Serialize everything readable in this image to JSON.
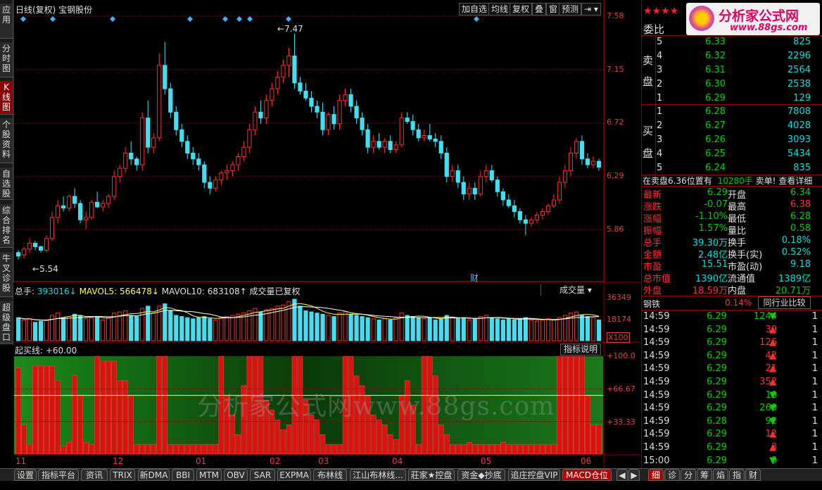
{
  "left_nav": [
    "应用",
    "分时图",
    "K线图",
    "个股资料",
    "自选股",
    "综合排名",
    "牛叉诊股",
    "超级盘口"
  ],
  "header": {
    "title": "日线(复权)  宝钢股份"
  },
  "toolbar": [
    "加自选",
    "均线",
    "复权",
    "叠",
    "窗",
    "预测"
  ],
  "price_axis": [
    "7.58",
    "7.15",
    "6.72",
    "6.29",
    "5.86"
  ],
  "annotations": {
    "high": "7.47",
    "low": "5.54",
    "cai_marker": "财"
  },
  "volume": {
    "header_prefix": "总手:",
    "total": "393016↓",
    "mavol5_label": "MAVOL5:",
    "mavol5": "566478↓",
    "mavol10_label": "MAVOL10:",
    "mavol10": "683108↑",
    "note": "成交量已复权",
    "selector": "成交量",
    "axis": [
      "36349",
      "18174",
      "X100"
    ]
  },
  "indicator": {
    "header": "起买线: +60.00",
    "button": "指标说明",
    "axis": [
      "+100.0",
      "+66.67",
      "+33.33"
    ]
  },
  "watermark": "分析家公式网www.88gs.com",
  "x_axis": [
    "11",
    "12",
    "01",
    "02",
    "03",
    "04",
    "05",
    "06"
  ],
  "tabs": [
    "设置",
    "指标平台",
    "资讯",
    "TRIX",
    "新DMA",
    "BBI",
    "MTM",
    "OBV",
    "SAR",
    "EXPMA",
    "布林线",
    "江山布林线...",
    "莊家★控盘",
    "资金◆抄底",
    "追庄控盘VIP",
    "MACD仓位"
  ],
  "right_panel": {
    "stars": "★★★★",
    "logo_text": "分析家公式网",
    "logo_url": "www.88gs.com",
    "weibi_label": "委比",
    "sell_label": [
      "卖",
      "盘"
    ],
    "buy_label": [
      "买",
      "盘"
    ],
    "sell": [
      {
        "n": "5",
        "price": "6.33",
        "vol": "825"
      },
      {
        "n": "4",
        "price": "6.32",
        "vol": "2296"
      },
      {
        "n": "3",
        "price": "6.31",
        "vol": "2564"
      },
      {
        "n": "2",
        "price": "6.30",
        "vol": "2538"
      },
      {
        "n": "1",
        "price": "6.29",
        "vol": "129"
      }
    ],
    "buy": [
      {
        "n": "1",
        "price": "6.28",
        "vol": "7808"
      },
      {
        "n": "2",
        "price": "6.27",
        "vol": "4028"
      },
      {
        "n": "3",
        "price": "6.26",
        "vol": "3093"
      },
      {
        "n": "4",
        "price": "6.25",
        "vol": "5434"
      },
      {
        "n": "5",
        "price": "6.24",
        "vol": "835"
      }
    ],
    "notice_left": "在卖盘6.36位置有",
    "notice_mid": "10280手",
    "notice_right": "卖单! 查看详细",
    "stats": [
      {
        "l1": "最新",
        "v1": "6.29",
        "l2": "开盘",
        "v2": "6.34"
      },
      {
        "l1": "涨跌",
        "v1": "-0.07",
        "l2": "最高",
        "v2": "6.38"
      },
      {
        "l1": "涨幅",
        "v1": "-1.10%",
        "l2": "最低",
        "v2": "6.28"
      },
      {
        "l1": "振幅",
        "v1": "1.57%",
        "l2": "量比",
        "v2": "0.58"
      },
      {
        "l1": "总手",
        "v1": "39.30万",
        "l2": "换手",
        "v2": "0.18%"
      },
      {
        "l1": "金额",
        "v1": "2.48亿",
        "l2": "换手(实)",
        "v2": "0.52%"
      },
      {
        "l1": "市盈",
        "v1": "15.51",
        "l2": "市盈(动)",
        "v2": "9.18"
      },
      {
        "l1": "总市值",
        "v1": "1390亿",
        "l2": "流通值",
        "v2": "1389亿"
      },
      {
        "l1": "外盘",
        "v1": "18.59万",
        "l2": "内盘",
        "v2": "20.71万"
      }
    ],
    "sector": "钢铁",
    "sector_pct": "0.14%",
    "sector_btn": "同行业比较",
    "trades": [
      {
        "t": "14:59",
        "p": "6.29",
        "v": "1244",
        "d": "down",
        "c": "1"
      },
      {
        "t": "14:59",
        "p": "6.29",
        "v": "39",
        "d": "up",
        "c": "1"
      },
      {
        "t": "14:59",
        "p": "6.29",
        "v": "126",
        "d": "up",
        "c": "1"
      },
      {
        "t": "14:59",
        "p": "6.29",
        "v": "42",
        "d": "up",
        "c": "1"
      },
      {
        "t": "14:59",
        "p": "6.29",
        "v": "21",
        "d": "up",
        "c": "1"
      },
      {
        "t": "14:59",
        "p": "6.29",
        "v": "352",
        "d": "up",
        "c": "1"
      },
      {
        "t": "14:59",
        "p": "6.29",
        "v": "10",
        "d": "down",
        "c": "1"
      },
      {
        "t": "14:59",
        "p": "6.29",
        "v": "260",
        "d": "down",
        "c": "1"
      },
      {
        "t": "14:59",
        "p": "6.28",
        "v": "92",
        "d": "down",
        "c": "1"
      },
      {
        "t": "14:59",
        "p": "6.29",
        "v": "12",
        "d": "up",
        "c": "1"
      },
      {
        "t": "14:59",
        "p": "6.29",
        "v": "3",
        "d": "up",
        "c": "1"
      },
      {
        "t": "15:00",
        "p": "6.29",
        "v": "0",
        "d": "down",
        "c": "1"
      }
    ],
    "bottom_tabs": [
      "细",
      "诊",
      "分",
      "筹",
      "焰",
      "指",
      "财"
    ]
  },
  "colors": {
    "up": "#ff3030",
    "down": "#40e0f0",
    "grid": "#8b0000",
    "ma": "#ffffff",
    "bg": "#000000"
  },
  "chart_data": {
    "type": "candlestick",
    "y_range": [
      5.4,
      7.65
    ],
    "candles": [
      [
        5.6,
        5.62,
        5.54,
        5.57
      ],
      [
        5.58,
        5.65,
        5.55,
        5.63
      ],
      [
        5.63,
        5.72,
        5.6,
        5.68
      ],
      [
        5.68,
        5.7,
        5.62,
        5.65
      ],
      [
        5.65,
        5.66,
        5.6,
        5.62
      ],
      [
        5.62,
        5.75,
        5.6,
        5.72
      ],
      [
        5.72,
        5.95,
        5.7,
        5.9
      ],
      [
        5.9,
        6.05,
        5.85,
        6.0
      ],
      [
        6.0,
        6.08,
        5.95,
        5.98
      ],
      [
        5.98,
        6.1,
        5.95,
        6.08
      ],
      [
        6.08,
        6.15,
        5.98,
        6.02
      ],
      [
        6.02,
        6.05,
        5.85,
        5.88
      ],
      [
        5.88,
        5.95,
        5.8,
        5.9
      ],
      [
        5.9,
        6.05,
        5.88,
        6.03
      ],
      [
        6.03,
        6.12,
        5.98,
        5.99
      ],
      [
        5.99,
        6.05,
        5.95,
        6.02
      ],
      [
        6.02,
        6.1,
        5.98,
        6.08
      ],
      [
        6.08,
        6.3,
        6.05,
        6.25
      ],
      [
        6.25,
        6.35,
        6.2,
        6.32
      ],
      [
        6.32,
        6.5,
        6.28,
        6.45
      ],
      [
        6.45,
        6.55,
        6.35,
        6.4
      ],
      [
        6.4,
        6.42,
        6.3,
        6.35
      ],
      [
        6.35,
        6.8,
        6.3,
        6.75
      ],
      [
        6.75,
        6.9,
        6.45,
        6.5
      ],
      [
        6.5,
        6.62,
        6.45,
        6.58
      ],
      [
        6.58,
        7.3,
        6.55,
        7.2
      ],
      [
        7.2,
        7.4,
        6.95,
        7.0
      ],
      [
        7.0,
        7.05,
        6.75,
        6.8
      ],
      [
        6.8,
        6.85,
        6.6,
        6.65
      ],
      [
        6.65,
        6.7,
        6.5,
        6.55
      ],
      [
        6.55,
        6.6,
        6.4,
        6.45
      ],
      [
        6.45,
        6.5,
        6.35,
        6.4
      ],
      [
        6.4,
        6.45,
        6.3,
        6.35
      ],
      [
        6.35,
        6.38,
        6.15,
        6.2
      ],
      [
        6.2,
        6.25,
        6.1,
        6.15
      ],
      [
        6.15,
        6.25,
        6.12,
        6.22
      ],
      [
        6.22,
        6.3,
        6.18,
        6.28
      ],
      [
        6.28,
        6.35,
        6.22,
        6.3
      ],
      [
        6.3,
        6.38,
        6.25,
        6.35
      ],
      [
        6.35,
        6.45,
        6.3,
        6.42
      ],
      [
        6.42,
        6.55,
        6.38,
        6.5
      ],
      [
        6.5,
        6.7,
        6.45,
        6.65
      ],
      [
        6.65,
        6.85,
        6.6,
        6.8
      ],
      [
        6.8,
        6.9,
        6.7,
        6.75
      ],
      [
        6.75,
        6.95,
        6.7,
        6.9
      ],
      [
        6.9,
        7.05,
        6.85,
        7.0
      ],
      [
        7.0,
        7.15,
        6.95,
        7.1
      ],
      [
        7.1,
        7.25,
        7.05,
        7.2
      ],
      [
        7.2,
        7.35,
        7.1,
        7.28
      ],
      [
        7.28,
        7.47,
        7.0,
        7.05
      ],
      [
        7.05,
        7.1,
        6.95,
        6.98
      ],
      [
        6.98,
        7.05,
        6.9,
        6.92
      ],
      [
        6.92,
        6.98,
        6.8,
        6.85
      ],
      [
        6.85,
        6.9,
        6.75,
        6.8
      ],
      [
        6.8,
        6.88,
        6.6,
        6.65
      ],
      [
        6.65,
        6.8,
        6.6,
        6.78
      ],
      [
        6.78,
        6.85,
        6.65,
        6.7
      ],
      [
        6.7,
        6.95,
        6.65,
        6.9
      ],
      [
        6.9,
        7.0,
        6.85,
        6.95
      ],
      [
        6.95,
        7.0,
        6.8,
        6.85
      ],
      [
        6.85,
        6.9,
        6.7,
        6.75
      ],
      [
        6.75,
        6.8,
        6.6,
        6.65
      ],
      [
        6.65,
        6.7,
        6.45,
        6.5
      ],
      [
        6.5,
        6.6,
        6.45,
        6.55
      ],
      [
        6.55,
        6.62,
        6.48,
        6.5
      ],
      [
        6.5,
        6.58,
        6.45,
        6.55
      ],
      [
        6.55,
        6.6,
        6.45,
        6.48
      ],
      [
        6.48,
        6.55,
        6.45,
        6.52
      ],
      [
        6.52,
        6.8,
        6.5,
        6.75
      ],
      [
        6.75,
        6.8,
        6.7,
        6.72
      ],
      [
        6.72,
        6.78,
        6.6,
        6.65
      ],
      [
        6.65,
        6.7,
        6.55,
        6.58
      ],
      [
        6.58,
        6.65,
        6.55,
        6.6
      ],
      [
        6.6,
        6.7,
        6.55,
        6.57
      ],
      [
        6.57,
        6.62,
        6.5,
        6.55
      ],
      [
        6.55,
        6.6,
        6.4,
        6.45
      ],
      [
        6.45,
        6.5,
        6.2,
        6.25
      ],
      [
        6.25,
        6.35,
        6.2,
        6.3
      ],
      [
        6.3,
        6.35,
        6.15,
        6.2
      ],
      [
        6.2,
        6.25,
        6.05,
        6.1
      ],
      [
        6.1,
        6.2,
        6.05,
        6.15
      ],
      [
        6.15,
        6.2,
        6.05,
        6.1
      ],
      [
        6.1,
        6.3,
        6.08,
        6.25
      ],
      [
        6.25,
        6.35,
        6.2,
        6.3
      ],
      [
        6.3,
        6.35,
        6.2,
        6.22
      ],
      [
        6.22,
        6.25,
        6.08,
        6.12
      ],
      [
        6.12,
        6.15,
        6.0,
        6.05
      ],
      [
        6.05,
        6.1,
        5.98,
        6.0
      ],
      [
        6.0,
        6.05,
        5.9,
        5.95
      ],
      [
        5.95,
        5.98,
        5.85,
        5.88
      ],
      [
        5.88,
        5.92,
        5.75,
        5.85
      ],
      [
        5.85,
        5.9,
        5.82,
        5.88
      ],
      [
        5.88,
        5.95,
        5.85,
        5.92
      ],
      [
        5.92,
        5.98,
        5.88,
        5.95
      ],
      [
        5.95,
        6.02,
        5.92,
        6.0
      ],
      [
        6.0,
        6.1,
        5.98,
        6.05
      ],
      [
        6.05,
        6.25,
        6.02,
        6.2
      ],
      [
        6.2,
        6.35,
        6.15,
        6.3
      ],
      [
        6.3,
        6.5,
        6.25,
        6.45
      ],
      [
        6.45,
        6.58,
        6.4,
        6.55
      ],
      [
        6.55,
        6.6,
        6.35,
        6.4
      ],
      [
        6.4,
        6.45,
        6.32,
        6.35
      ],
      [
        6.35,
        6.42,
        6.32,
        6.38
      ],
      [
        6.38,
        6.4,
        6.3,
        6.33
      ]
    ],
    "volume": [
      20,
      18,
      19,
      16,
      17,
      18,
      22,
      24,
      20,
      21,
      23,
      22,
      19,
      20,
      21,
      18,
      20,
      24,
      25,
      26,
      22,
      21,
      28,
      30,
      24,
      30,
      32,
      26,
      22,
      21,
      20,
      19,
      20,
      21,
      19,
      18,
      20,
      21,
      22,
      23,
      24,
      26,
      28,
      25,
      27,
      28,
      30,
      31,
      34,
      36,
      30,
      26,
      25,
      24,
      23,
      22,
      21,
      24,
      25,
      23,
      22,
      21,
      20,
      19,
      18,
      19,
      18,
      20,
      24,
      22,
      21,
      20,
      19,
      20,
      18,
      19,
      22,
      20,
      19,
      20,
      18,
      19,
      21,
      22,
      20,
      19,
      18,
      19,
      18,
      19,
      20,
      18,
      17,
      18,
      19,
      18,
      20,
      22,
      24,
      25,
      22,
      21,
      20,
      18
    ],
    "indicator": [
      88,
      30,
      10,
      90,
      90,
      90,
      90,
      75,
      8,
      12,
      80,
      60,
      12,
      10,
      100,
      95,
      95,
      95,
      75,
      75,
      60,
      10,
      10,
      10,
      10,
      100,
      100,
      10,
      10,
      10,
      10,
      10,
      10,
      10,
      10,
      10,
      100,
      60,
      40,
      20,
      70,
      100,
      100,
      100,
      55,
      45,
      35,
      25,
      30,
      100,
      100,
      55,
      40,
      35,
      20,
      10,
      10,
      10,
      100,
      100,
      80,
      70,
      60,
      40,
      35,
      30,
      20,
      15,
      60,
      75,
      50,
      10,
      100,
      100,
      80,
      30,
      20,
      10,
      10,
      10,
      12,
      10,
      10,
      10,
      10,
      10,
      12,
      10,
      10,
      10,
      10,
      10,
      10,
      10,
      10,
      10,
      100,
      100,
      100,
      100,
      100,
      60,
      30,
      30
    ]
  }
}
